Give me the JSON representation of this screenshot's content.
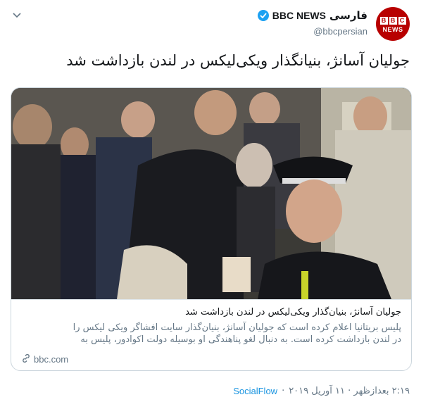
{
  "account": {
    "name_fa": "فارسی",
    "name_en": "BBC NEWS",
    "handle": "@bbcpersian",
    "avatar_letters": [
      "B",
      "B",
      "C"
    ],
    "avatar_caption": "NEWS",
    "brand_color": "#b80000",
    "verified_icon": "verified-badge-icon"
  },
  "tweet": {
    "text": "جولیان آسانژ، بنیانگذار ویکی‌لیکس در لندن بازداشت شد"
  },
  "card": {
    "image_alt": "photo",
    "title": "جولیان آسانژ، بنیان‌گذار ویکی‌لیکس در لندن بازداشت شد",
    "description_lines": [
      "پلیس بریتانیا اعلام کرده است که جولیان آسانژ، بنیان‌گذار سایت افشاگر ویکی لیکس را",
      "در لندن بازداشت کرده است. به دنبال لغو پناهندگی او بوسیله دولت اکوادور، پلیس به"
    ],
    "domain": "bbc.com",
    "link_icon": "link-icon"
  },
  "meta": {
    "time": "۲:۱۹ بعدازظهر · ۱۱ آوریل ۲۰۱۹",
    "separator": "·",
    "source": "SocialFlow"
  },
  "colors": {
    "text_primary": "#14171a",
    "text_secondary": "#657786",
    "link": "#1b95e0",
    "verified": "#1da1f2",
    "border": "#ccd6dd"
  }
}
